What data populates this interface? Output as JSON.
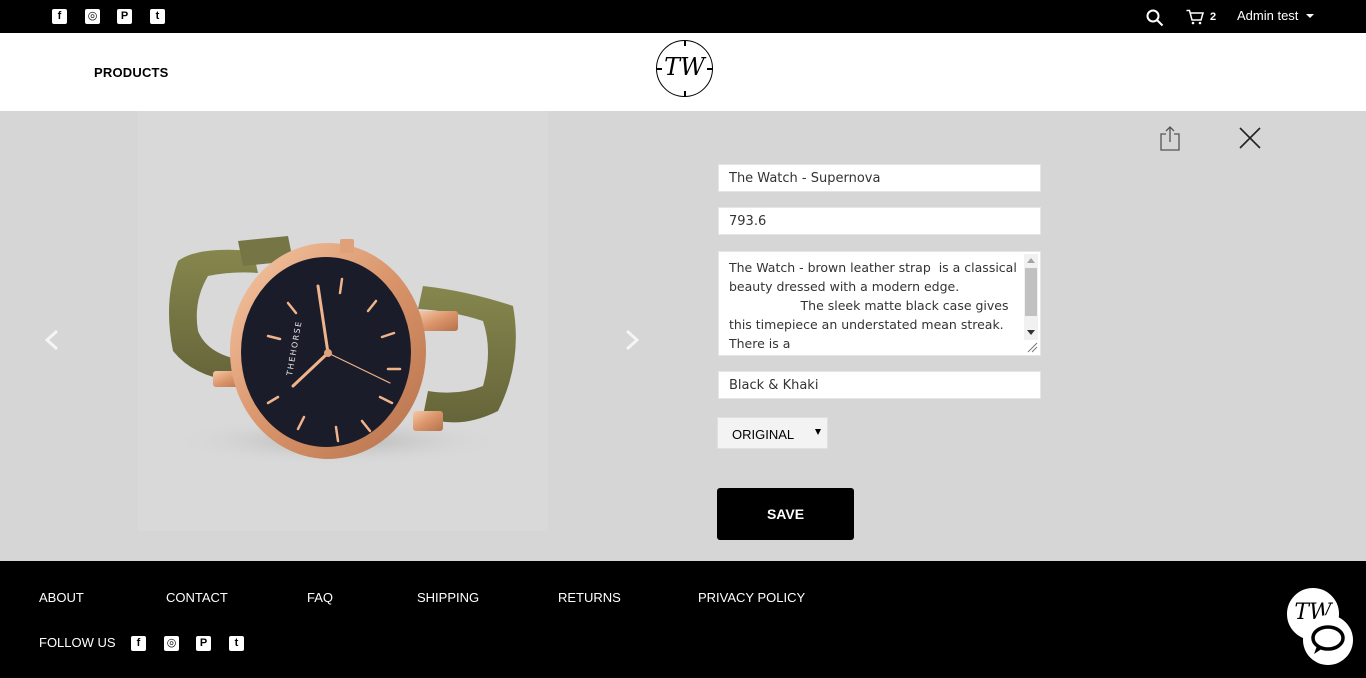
{
  "topbar": {
    "social": [
      "facebook-icon",
      "instagram-icon",
      "pinterest-icon",
      "twitter-icon"
    ],
    "social_glyphs": [
      "f",
      "◎",
      "P",
      "t"
    ],
    "cart_count": "2",
    "user_name": "Admin test"
  },
  "header": {
    "nav_label": "PRODUCTS",
    "logo_text": "TW"
  },
  "product": {
    "name": "The Watch - Supernova",
    "price": "793.6",
    "description": "The Watch - brown leather strap  is a classical beauty dressed with a modern edge.\n                  The sleek matte black case gives this timepiece an understated mean streak. There is a\n                  subtle and irresistible texture to the",
    "color": "Black & Khaki",
    "type_selected": "ORIGINAL",
    "save_label": "SAVE",
    "image_brand_text": "THEHORSE"
  },
  "footer": {
    "links": [
      "ABOUT",
      "CONTACT",
      "FAQ",
      "SHIPPING",
      "RETURNS",
      "PRIVACY POLICY"
    ],
    "follow_label": "FOLLOW US",
    "logo_text": "TW"
  },
  "colors": {
    "bar": "#000000",
    "stage": "#d6d6d6",
    "strap": "#7a7a42",
    "case": "#e0a07a",
    "dial": "#1a1c2a"
  }
}
